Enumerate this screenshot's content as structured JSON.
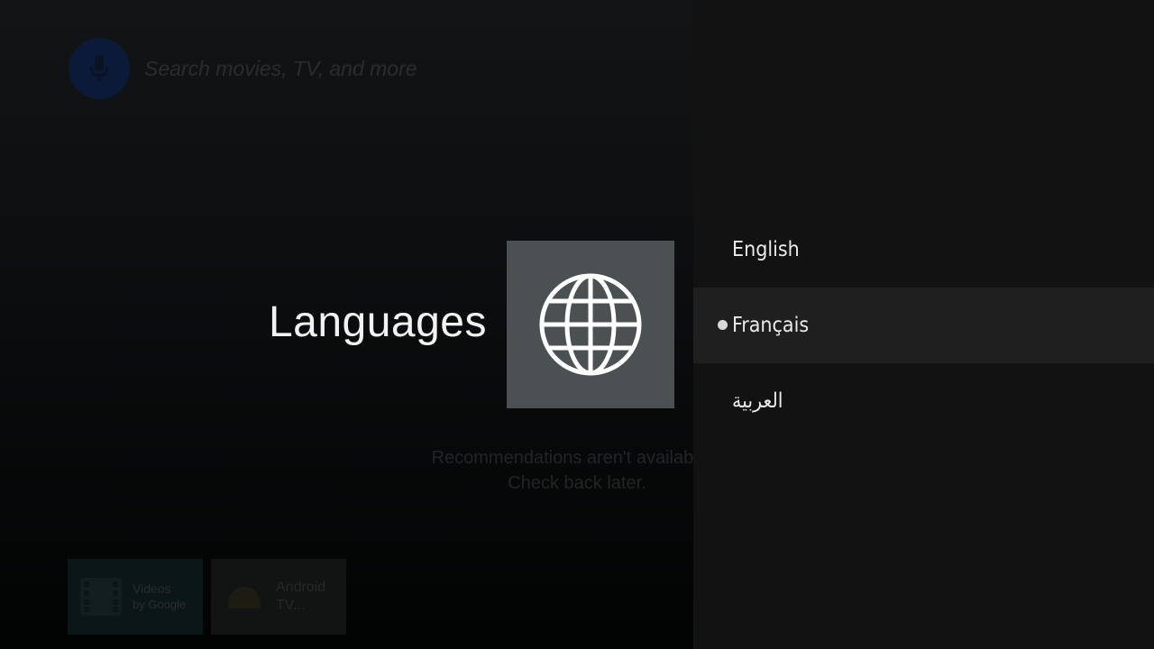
{
  "launcher": {
    "search_placeholder": "Search movies, TV, and more",
    "recommendations_line1": "Recommendations aren't available ri",
    "recommendations_line2": "Check back later.",
    "apps": [
      {
        "title": "Videos",
        "subtitle": "by Google",
        "icon": "film-icon"
      },
      {
        "title": "Android",
        "subtitle": "TV...",
        "icon": "android-icon"
      }
    ]
  },
  "guidance": {
    "title": "Languages",
    "icon": "globe-icon"
  },
  "languages": {
    "selected_index": 1,
    "items": [
      {
        "label": "English"
      },
      {
        "label": "Français"
      },
      {
        "label": "العربية"
      }
    ]
  },
  "colors": {
    "panel_background": "#121212",
    "focused_row": "#1f1f1f",
    "icon_box": "#4b5153",
    "mic_circle": "#0c1a3a"
  }
}
